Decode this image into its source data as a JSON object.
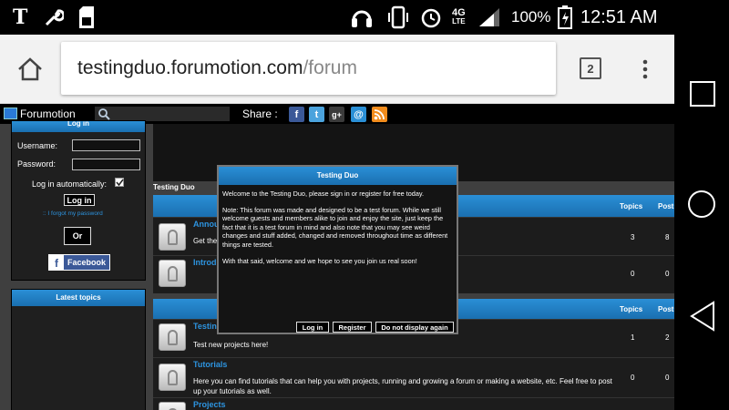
{
  "status_bar": {
    "carrier_logo": "T",
    "lte_top": "4G",
    "lte_bottom": "LTE",
    "battery_percent": "100%",
    "time": "12:51 AM"
  },
  "browser": {
    "url_host": "testingduo.forumotion.com",
    "url_path": "/forum",
    "tab_count": "2"
  },
  "toolbar": {
    "site_name": "Forumotion",
    "share_label": "Share :",
    "share_icons": [
      "f",
      "t",
      "g+",
      "@",
      "rss"
    ]
  },
  "login_panel": {
    "title": "Log in",
    "username_label": "Username:",
    "password_label": "Password:",
    "auto_login_label": "Log in automatically:",
    "login_button": "Log in",
    "forgot_link": ":: I forgot my password",
    "or_label": "Or",
    "facebook_button": "Facebook"
  },
  "latest_topics": {
    "title": "Latest topics"
  },
  "category_1": {
    "name": "Testing Duo",
    "topics_header": "Topics",
    "posts_header": "Posts",
    "forums": [
      {
        "title": "Annou",
        "description": "Get the",
        "topics": "3",
        "posts": "8"
      },
      {
        "title": "Introd",
        "description": "",
        "topics": "0",
        "posts": "0"
      }
    ]
  },
  "category_2": {
    "topics_header": "Topics",
    "posts_header": "Posts",
    "forums": [
      {
        "title": "Testin",
        "description": "Test new projects here!",
        "topics": "1",
        "posts": "2"
      },
      {
        "title": "Tutorials",
        "description": "Here you can find tutorials that can help you with projects, running and growing a forum or making a website, etc. Feel free to post up your tutorials as well.",
        "topics": "0",
        "posts": "0"
      },
      {
        "title": "Projects",
        "description": "",
        "topics": "",
        "posts": ""
      }
    ]
  },
  "modal": {
    "title": "Testing Duo",
    "line1": "Welcome to the Testing Duo, please sign in or register for free today.",
    "line2": "Note: This forum was made and designed to be a test forum. While we still welcome guests and members alike to join and enjoy the site, just keep the fact that it is a test forum in mind and also note that you may see weird changes and stuff added, changed and removed throughout time as different things are tested.",
    "line3": "With that said, welcome and we hope to see you join us real soon!",
    "login_button": "Log in",
    "register_button": "Register",
    "dismiss_button": "Do not display again"
  },
  "colors": {
    "header_blue": "#1a7fc8",
    "link_blue": "#2d94e0",
    "facebook_blue": "#3b5998"
  }
}
